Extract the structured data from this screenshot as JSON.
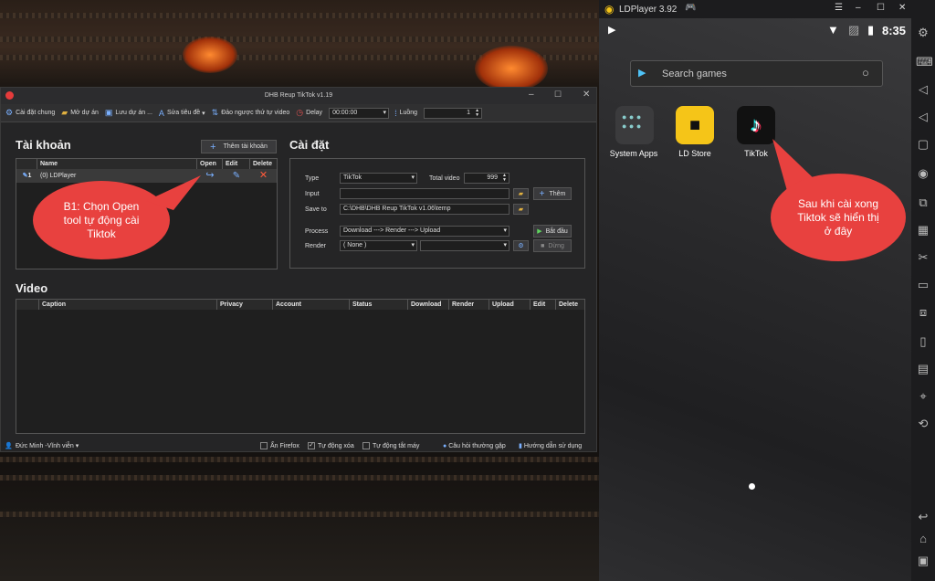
{
  "app": {
    "title": "DHB Reup TikTok v1.19",
    "menu": [
      {
        "icon": "gear-icon",
        "label": "Cài đặt chung"
      },
      {
        "icon": "folder-icon",
        "label": "Mở dự án"
      },
      {
        "icon": "save-icon",
        "label": "Lưu dự án ..."
      },
      {
        "icon": "text-icon",
        "label": "Sửa tiêu đề"
      },
      {
        "icon": "sort-icon",
        "label": "Đảo ngược thứ tự video"
      },
      {
        "icon": "clock-icon",
        "label": "Delay"
      },
      {
        "icon": "threads-icon",
        "label": "Luồng"
      }
    ],
    "delay_value": "00:00:00",
    "threads_value": "1",
    "accounts": {
      "heading": "Tài khoản",
      "add_button": "Thêm tài khoản",
      "columns": [
        "Name",
        "Open",
        "Edit",
        "Delete"
      ],
      "rows": [
        {
          "index": "1",
          "name": "(0) LDPlayer"
        }
      ]
    },
    "settings": {
      "heading": "Cài đặt",
      "type_label": "Type",
      "type_value": "TikTok",
      "total_label": "Total video",
      "total_value": "999",
      "input_label": "Input",
      "input_value": "",
      "add_button": "Thêm",
      "save_label": "Save to",
      "save_value": "C:\\DHB\\DHB Reup TikTok v1.06\\temp",
      "process_label": "Process",
      "process_value": "Download ---> Render ---> Upload",
      "start_button": "Bắt đầu",
      "render_label": "Render",
      "render_value": "( None )",
      "render_value2": "",
      "stop_button": "Dừng"
    },
    "video": {
      "heading": "Video",
      "columns": [
        "Caption",
        "Privacy",
        "Account",
        "Status",
        "Download",
        "Render",
        "Upload",
        "Edit",
        "Delete"
      ]
    },
    "status": {
      "user": "Đức Minh -Vĩnh viễn",
      "hide_firefox": "Ẩn Firefox",
      "auto_delete": "Tự động xóa",
      "auto_shutdown": "Tự động tắt máy",
      "faq": "Câu hỏi thường gặp",
      "guide": "Hướng dẫn sử dụng"
    }
  },
  "annotation_left": "B1: Chọn Open tool tự động cài Tiktok",
  "annotation_right": "Sau khi cài xong Tiktok sẽ hiển thị ở đây",
  "ld": {
    "title": "LDPlayer 3.92",
    "time": "8:35",
    "search_placeholder": "Search games",
    "apps": [
      {
        "label": "System Apps"
      },
      {
        "label": "LD Store"
      },
      {
        "label": "TikTok"
      }
    ]
  },
  "colors": {
    "bubble": "#e8413f",
    "ldstore": "#f5c518",
    "tiktok": "#111111"
  }
}
